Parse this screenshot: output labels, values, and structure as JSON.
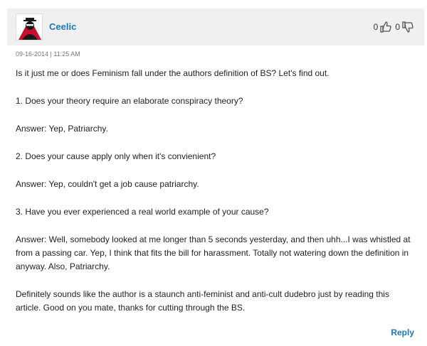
{
  "comment": {
    "username": "Ceelic",
    "timestamp": "09-16-2014 | 11:25 AM",
    "upvotes": "0",
    "downvotes": "0",
    "paragraphs": [
      "Is it just me or does Feminism fall under the authors definition of BS? Let's find out.",
      "1. Does your theory require an elaborate conspiracy theory?",
      "Answer: Yep, Patriarchy.",
      "2. Does your cause apply only when it's convienient?",
      "Answer: Yep, couldn't get a job cause patriarchy.",
      "3. Have you ever experienced a real world example of your cause?",
      "Answer: Well, somebody looked at me longer than 5 seconds yesterday, and then uhh...I was whistled at from a passing car. Yep, I think that fits the bill for harassment. Totally not watering down the definition in anyway. Also, Patriarchy.",
      "Definitely sounds like the author is a staunch anti-feminist and anti-cult dudebro just by reading this article. Good on you mate, thanks for cutting through the BS."
    ],
    "reply_label": "Reply"
  },
  "icons": {
    "avatar": "masked-figure-avatar",
    "upvote": "thumbs-up-icon",
    "downvote": "thumbs-down-icon"
  },
  "colors": {
    "accent": "#1a78b8",
    "header_bg": "#f0f0f0",
    "avatar_red": "#c8102e"
  }
}
